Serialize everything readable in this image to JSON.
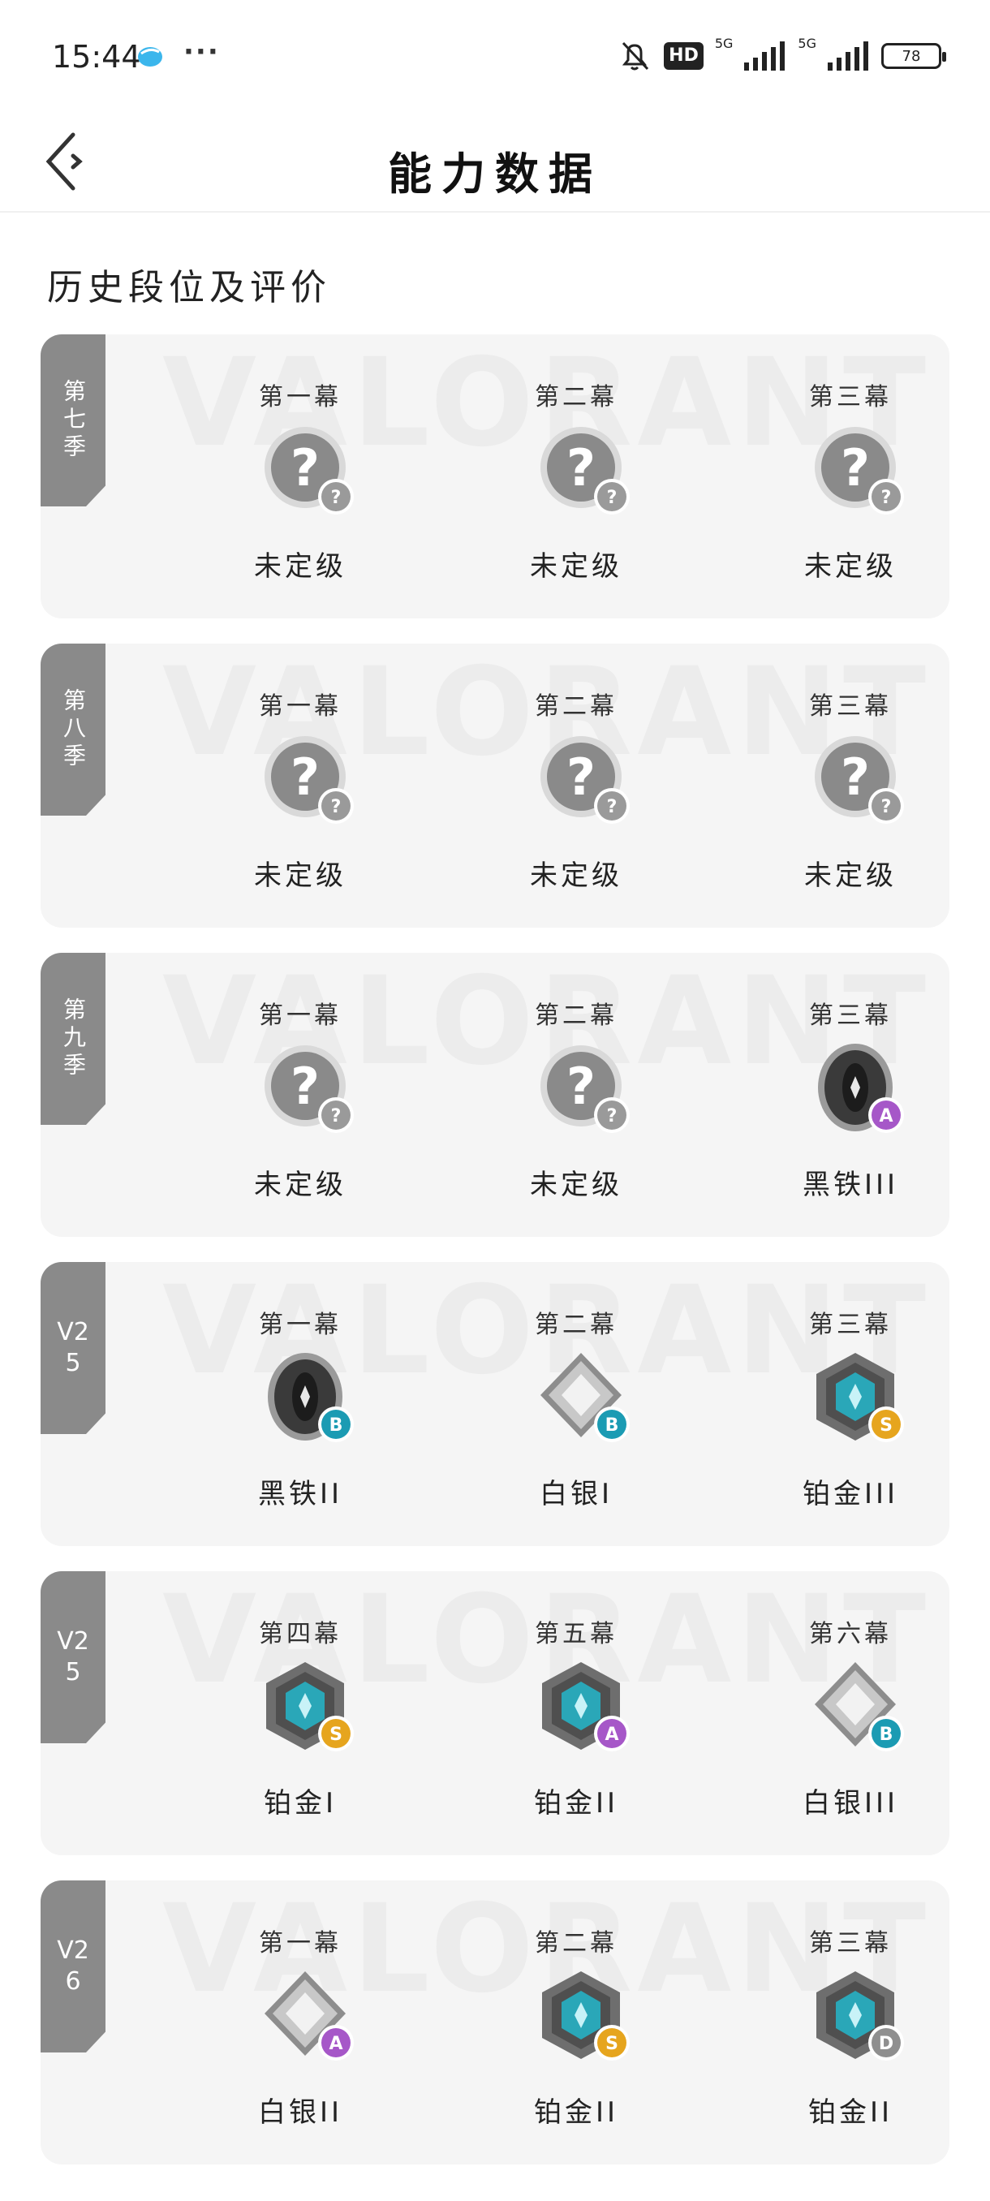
{
  "status_bar": {
    "time": "15:44",
    "hd_label": "HD",
    "net_1": "5G",
    "net_2": "5G",
    "battery": "78",
    "app_icon": "bird-app-icon",
    "more_icon": "more-dots-icon"
  },
  "header": {
    "title": "能力数据",
    "back_icon": "back-arrow-icon"
  },
  "section_title": "历史段位及评价",
  "watermark_text": "VALORANT",
  "colors": {
    "unranked": "#8a8a8a",
    "iron": "#3a3a3a",
    "silver": "#c8c8c8",
    "platinum": "#2aa7b8",
    "badge_S": "#e6a51e",
    "badge_A": "#a657c8",
    "badge_B": "#1b9bb3",
    "badge_D": "#8f8f8f",
    "badge_unranked": "#9a9a9a"
  },
  "seasons": [
    {
      "tab": "第七季",
      "acts": [
        {
          "act": "第一幕",
          "rank": "未定级",
          "tier": "unranked",
          "grade": "?"
        },
        {
          "act": "第二幕",
          "rank": "未定级",
          "tier": "unranked",
          "grade": "?"
        },
        {
          "act": "第三幕",
          "rank": "未定级",
          "tier": "unranked",
          "grade": "?"
        }
      ]
    },
    {
      "tab": "第八季",
      "acts": [
        {
          "act": "第一幕",
          "rank": "未定级",
          "tier": "unranked",
          "grade": "?"
        },
        {
          "act": "第二幕",
          "rank": "未定级",
          "tier": "unranked",
          "grade": "?"
        },
        {
          "act": "第三幕",
          "rank": "未定级",
          "tier": "unranked",
          "grade": "?"
        }
      ]
    },
    {
      "tab": "第九季",
      "acts": [
        {
          "act": "第一幕",
          "rank": "未定级",
          "tier": "unranked",
          "grade": "?"
        },
        {
          "act": "第二幕",
          "rank": "未定级",
          "tier": "unranked",
          "grade": "?"
        },
        {
          "act": "第三幕",
          "rank": "黑铁III",
          "tier": "iron",
          "grade": "A"
        }
      ]
    },
    {
      "tab": "V2\n5",
      "acts": [
        {
          "act": "第一幕",
          "rank": "黑铁II",
          "tier": "iron",
          "grade": "B"
        },
        {
          "act": "第二幕",
          "rank": "白银I",
          "tier": "silver",
          "grade": "B"
        },
        {
          "act": "第三幕",
          "rank": "铂金III",
          "tier": "platinum",
          "grade": "S"
        }
      ]
    },
    {
      "tab": "V2\n5",
      "acts": [
        {
          "act": "第四幕",
          "rank": "铂金I",
          "tier": "platinum",
          "grade": "S"
        },
        {
          "act": "第五幕",
          "rank": "铂金II",
          "tier": "platinum",
          "grade": "A"
        },
        {
          "act": "第六幕",
          "rank": "白银III",
          "tier": "silver",
          "grade": "B"
        }
      ]
    },
    {
      "tab": "V2\n6",
      "acts": [
        {
          "act": "第一幕",
          "rank": "白银II",
          "tier": "silver",
          "grade": "A"
        },
        {
          "act": "第二幕",
          "rank": "铂金II",
          "tier": "platinum",
          "grade": "S"
        },
        {
          "act": "第三幕",
          "rank": "铂金II",
          "tier": "platinum",
          "grade": "D"
        }
      ]
    }
  ]
}
